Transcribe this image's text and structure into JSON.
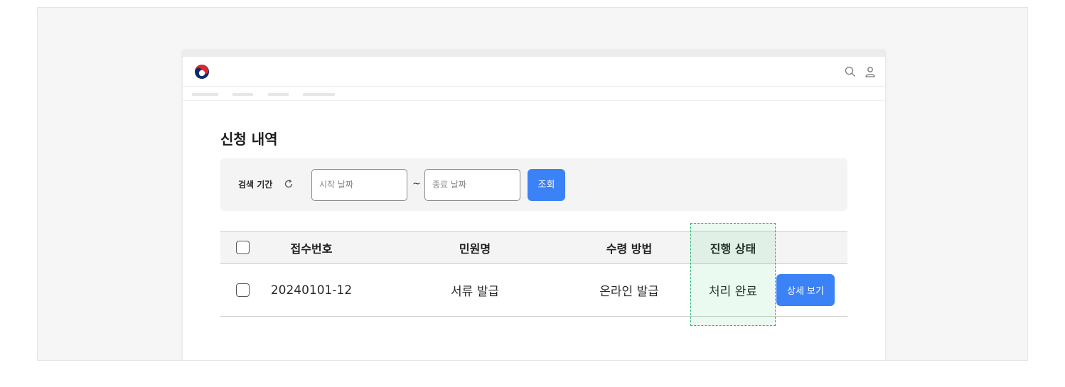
{
  "page": {
    "title": "신청 내역"
  },
  "filter": {
    "label": "검색 기간",
    "start_placeholder": "시작 날짜",
    "separator": "~",
    "end_placeholder": "종료 날짜",
    "search_label": "조회"
  },
  "table": {
    "headers": [
      "접수번호",
      "민원명",
      "수령 방법",
      "진행 상태"
    ],
    "rows": [
      {
        "receipt_no": "20240101-12",
        "name": "서류 발급",
        "method": "온라인 발급",
        "status": "처리 완료",
        "action": "상세 보기"
      }
    ]
  },
  "colors": {
    "accent": "#3b82f6",
    "highlight_border": "#1fb86a"
  },
  "icons": {
    "logo": "korea-government-logo-icon",
    "search": "search-icon",
    "user": "user-icon",
    "reset": "refresh-icon"
  }
}
